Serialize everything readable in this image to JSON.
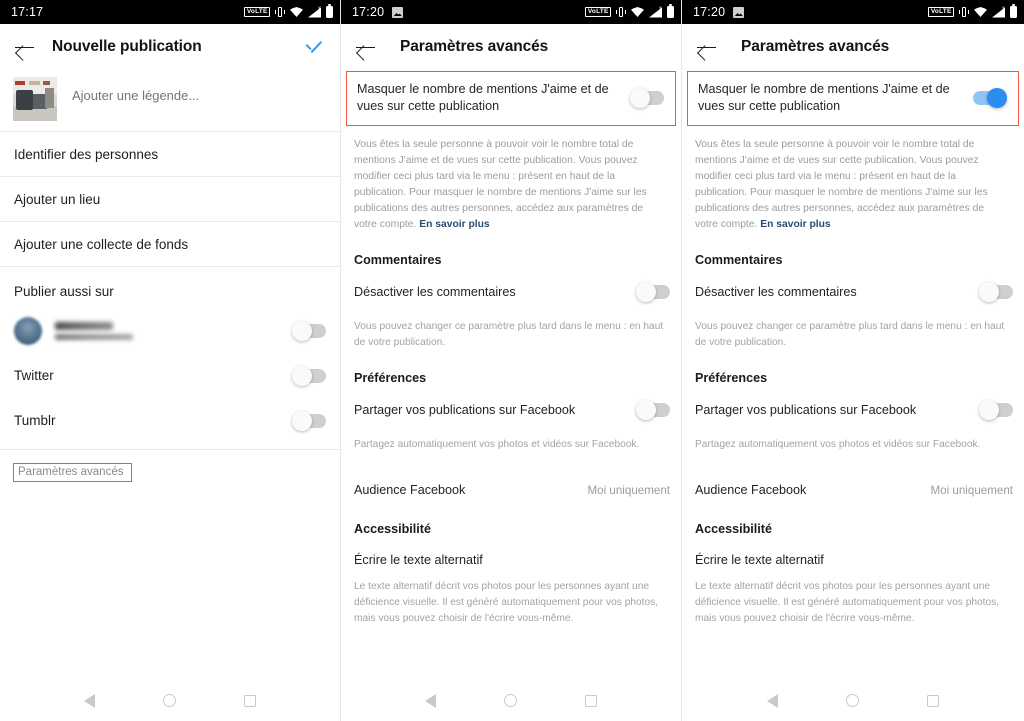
{
  "panels": [
    {
      "status": {
        "time": "17:17",
        "volte": "VoLTE",
        "has_image_icon": false
      },
      "appbar": {
        "title": "Nouvelle publication",
        "has_check": true
      },
      "caption": {
        "placeholder": "Ajouter une légende..."
      },
      "rows": [
        {
          "label": "Identifier des personnes"
        },
        {
          "label": "Ajouter un lieu"
        },
        {
          "label": "Ajouter une collecte de fonds"
        }
      ],
      "share_section": {
        "label": "Publier aussi sur"
      },
      "share_targets": [
        {
          "label": "",
          "redacted": true,
          "on": false
        },
        {
          "label": "Twitter",
          "redacted": false,
          "on": false
        },
        {
          "label": "Tumblr",
          "redacted": false,
          "on": false
        }
      ],
      "advanced_link": "Paramètres avancés"
    },
    {
      "status": {
        "time": "17:20",
        "volte": "VoLTE",
        "has_image_icon": true
      },
      "appbar": {
        "title": "Paramètres avancés",
        "has_check": false
      },
      "hide_likes": {
        "label": "Masquer le nombre de mentions J'aime et de vues sur cette publication",
        "on": false,
        "description": "Vous êtes la seule personne à pouvoir voir le nombre total de mentions J'aime et de vues sur cette publication. Vous pouvez modifier ceci plus tard via le menu : présent en haut de la publication. Pour masquer le nombre de mentions J'aime sur les publications des autres personnes, accédez aux paramètres de votre compte. ",
        "link": "En savoir plus"
      },
      "comments": {
        "heading": "Commentaires",
        "toggle_label": "Désactiver les commentaires",
        "toggle_on": false,
        "description": "Vous pouvez changer ce paramètre plus tard dans le menu : en haut de votre publication."
      },
      "preferences": {
        "heading": "Préférences",
        "share_label": "Partager vos publications sur Facebook",
        "share_on": false,
        "share_description": "Partagez automatiquement vos photos et vidéos sur Facebook.",
        "audience_label": "Audience Facebook",
        "audience_value": "Moi uniquement"
      },
      "accessibility": {
        "heading": "Accessibilité",
        "alt_label": "Écrire le texte alternatif",
        "alt_description": "Le texte alternatif décrit vos photos pour les personnes ayant une déficience visuelle. Il est généré automatiquement pour vos photos, mais vous pouvez choisir de l'écrire vous-même."
      }
    },
    {
      "status": {
        "time": "17:20",
        "volte": "VoLTE",
        "has_image_icon": true
      },
      "appbar": {
        "title": "Paramètres avancés",
        "has_check": false
      },
      "hide_likes": {
        "label": "Masquer le nombre de mentions J'aime et de vues sur cette publication",
        "on": true,
        "description": "Vous êtes la seule personne à pouvoir voir le nombre total de mentions J'aime et de vues sur cette publication. Vous pouvez modifier ceci plus tard via le menu : présent en haut de la publication. Pour masquer le nombre de mentions J'aime sur les publications des autres personnes, accédez aux paramètres de votre compte. ",
        "link": "En savoir plus"
      },
      "comments": {
        "heading": "Commentaires",
        "toggle_label": "Désactiver les commentaires",
        "toggle_on": false,
        "description": "Vous pouvez changer ce paramètre plus tard dans le menu : en haut de votre publication."
      },
      "preferences": {
        "heading": "Préférences",
        "share_label": "Partager vos publications sur Facebook",
        "share_on": false,
        "share_description": "Partagez automatiquement vos photos et vidéos sur Facebook.",
        "audience_label": "Audience Facebook",
        "audience_value": "Moi uniquement"
      },
      "accessibility": {
        "heading": "Accessibilité",
        "alt_label": "Écrire le texte alternatif",
        "alt_description": "Le texte alternatif décrit vos photos pour les personnes ayant une déficience visuelle. Il est généré automatiquement pour vos photos, mais vous pouvez choisir de l'écrire vous-même."
      }
    }
  ],
  "colors": {
    "accent_blue": "#2b8df0",
    "highlight_red": "#f4543c",
    "link_blue": "#2a4b72"
  }
}
